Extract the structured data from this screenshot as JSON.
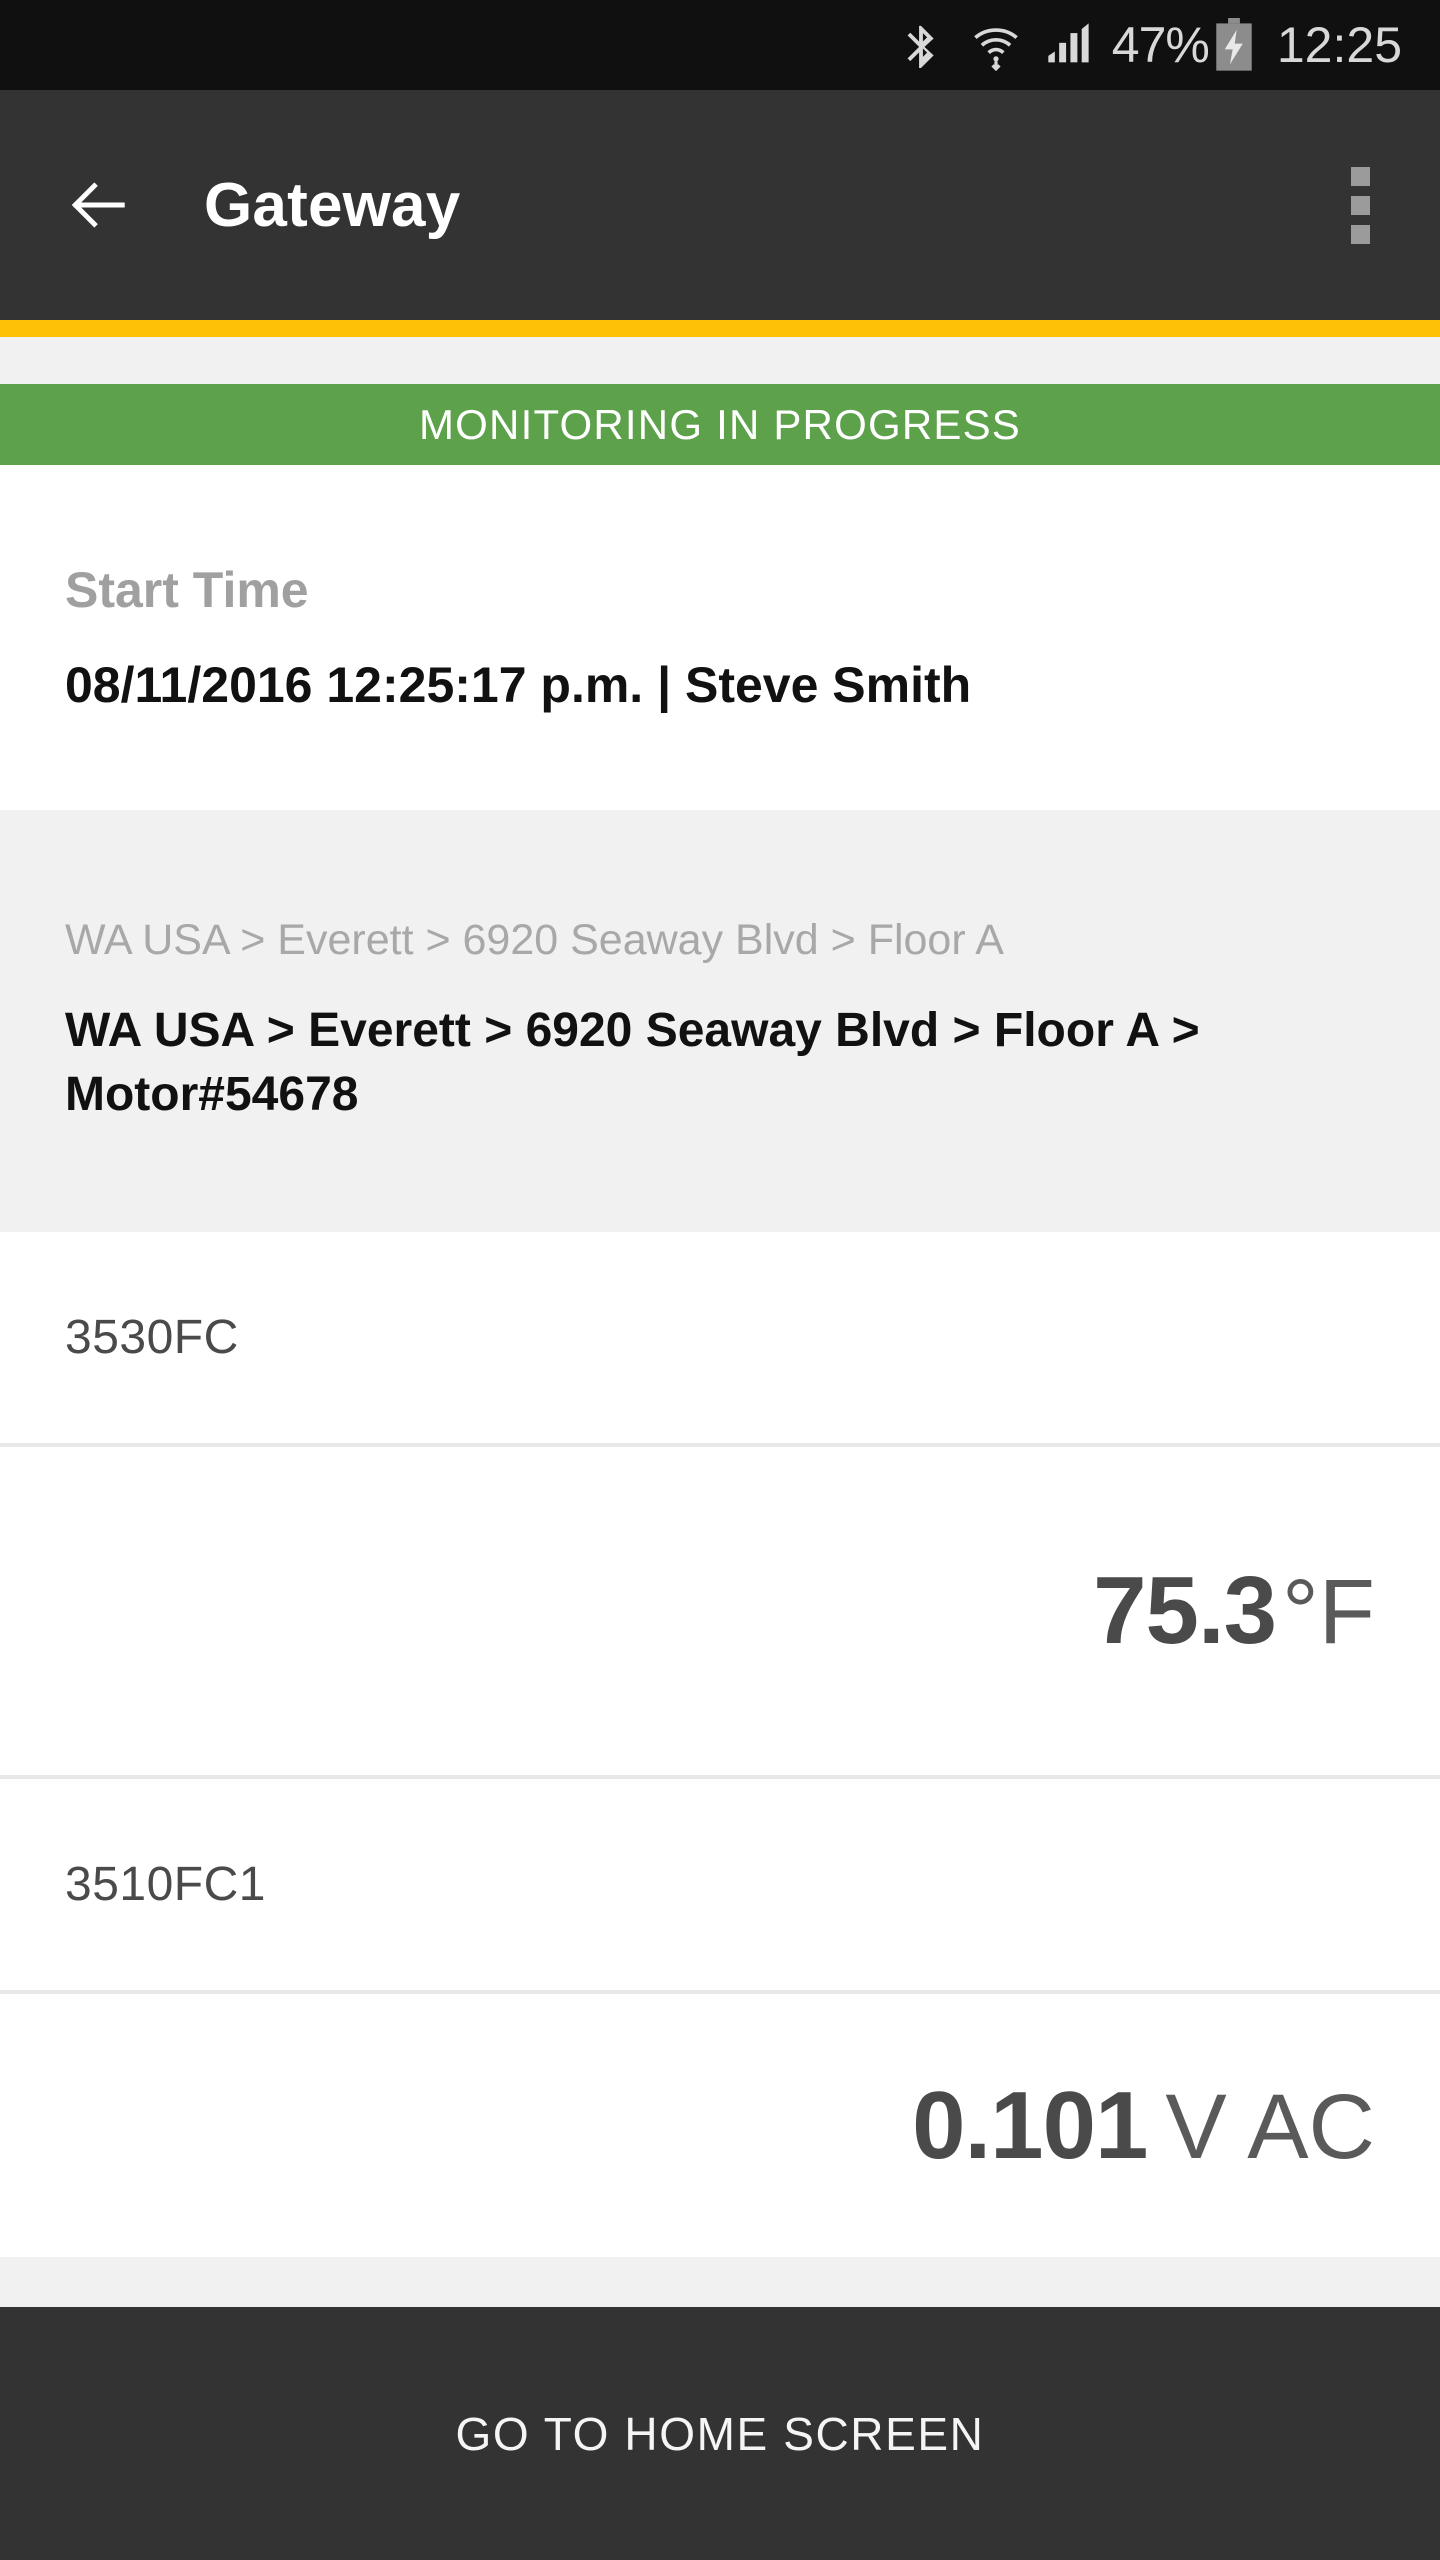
{
  "status_bar": {
    "bluetooth_icon": "bluetooth-icon",
    "wifi_icon": "wifi-icon",
    "signal_icon": "cellular-signal-icon",
    "battery_percent": "47%",
    "battery_icon": "battery-charging-icon",
    "clock": "12:25"
  },
  "app_bar": {
    "back_icon": "back-arrow-icon",
    "title": "Gateway",
    "overflow_icon": "overflow-menu-icon"
  },
  "accent_color": "#FFC107",
  "status_banner": {
    "text": "MONITORING IN PROGRESS",
    "color": "#5DA14A"
  },
  "start_time": {
    "label": "Start Time",
    "value": "08/11/2016 12:25:17 p.m. | Steve Smith"
  },
  "location": {
    "parent_path": "WA USA > Everett > 6920 Seaway Blvd > Floor A",
    "full_path": "WA USA > Everett > 6920 Seaway Blvd > Floor A > Motor#54678"
  },
  "readings": [
    {
      "name": "3530FC",
      "value": "75.3",
      "unit": "°F",
      "unit_spaced": false
    },
    {
      "name": "3510FC1",
      "value": "0.101",
      "unit": "V AC",
      "unit_spaced": true
    }
  ],
  "footer": {
    "home_button_label": "GO TO HOME SCREEN"
  }
}
